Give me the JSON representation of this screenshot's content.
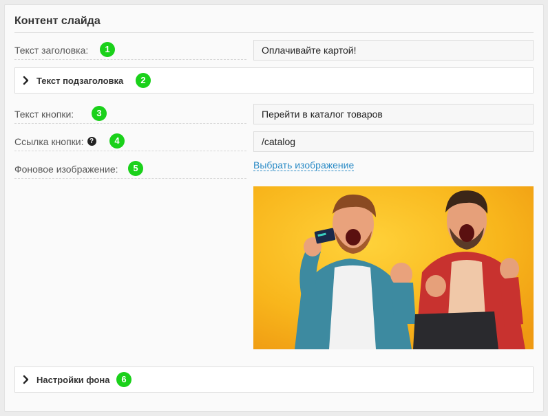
{
  "section": {
    "title": "Контент слайда"
  },
  "fields": {
    "heading": {
      "label": "Текст заголовка:",
      "value": "Оплачивайте картой!",
      "badge": "1"
    },
    "button_text": {
      "label": "Текст кнопки:",
      "value": "Перейти в каталог товаров",
      "badge": "3"
    },
    "button_link": {
      "label": "Ссылка кнопки:",
      "value": "/catalog",
      "badge": "4",
      "help_icon": "question-circle-icon"
    },
    "background": {
      "label": "Фоновое изображение:",
      "badge": "5",
      "link_label": "Выбрать изображение"
    }
  },
  "collapsibles": {
    "subheading": {
      "label": "Текст подзаголовка",
      "badge": "2",
      "icon": "chevron-right-icon"
    },
    "bg_settings": {
      "label": "Настройки фона",
      "badge": "6",
      "icon": "chevron-right-icon"
    }
  },
  "colors": {
    "badge": "#1ad11a",
    "link": "#2b8bc6",
    "image_background": "#f4b71a"
  }
}
